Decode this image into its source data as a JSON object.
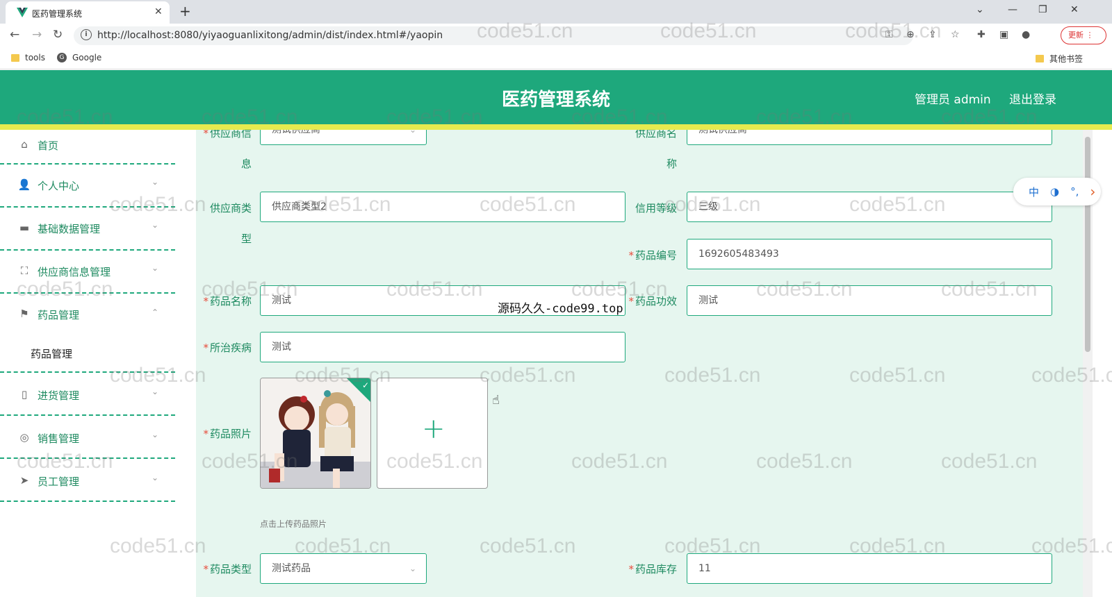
{
  "browser": {
    "tab_title": "医药管理系统",
    "url": "http://localhost:8080/yiyaoguanlixitong/admin/dist/index.html#/yaopin",
    "update_label": "更新",
    "bookmarks": [
      "tools",
      "Google"
    ],
    "other_bookmarks": "其他书签"
  },
  "header": {
    "title": "医药管理系统",
    "user_label": "管理员 admin",
    "logout_label": "退出登录"
  },
  "sidebar": {
    "items": [
      {
        "label": "首页"
      },
      {
        "label": "个人中心"
      },
      {
        "label": "基础数据管理"
      },
      {
        "label": "供应商信息管理"
      },
      {
        "label": "药品管理"
      },
      {
        "label": "进货管理"
      },
      {
        "label": "销售管理"
      },
      {
        "label": "员工管理"
      }
    ],
    "sub_active": "药品管理"
  },
  "form": {
    "supplier_info_label_a": "供应商信",
    "supplier_info_label_b": "息",
    "supplier_info_value": "测试供应商",
    "supplier_name_label_a": "供应商名",
    "supplier_name_label_b": "称",
    "supplier_name_value": "测试供应商",
    "supplier_type_label_a": "供应商类",
    "supplier_type_label_b": "型",
    "supplier_type_value": "供应商类型2",
    "credit_label": "信用等级",
    "credit_value": "三级",
    "drug_no_label": "药品编号",
    "drug_no_value": "1692605483493",
    "drug_name_label": "药品名称",
    "drug_name_value": "测试",
    "drug_effect_label": "药品功效",
    "drug_effect_value": "测试",
    "disease_label": "所治疾病",
    "disease_value": "测试",
    "photo_label": "药品照片",
    "upload_tip": "点击上传药品照片",
    "drug_type_label": "药品类型",
    "drug_type_value": "测试药品",
    "stock_label": "药品库存",
    "stock_value": "11"
  },
  "overlay_text": "源码久久-code99.top",
  "watermark": "code51.cn",
  "float_toolbar": [
    "中",
    "◑",
    "°,",
    "›"
  ],
  "colors": {
    "primary": "#1ea87c",
    "accent_line": "#e6ea4f",
    "main_bg": "#e6f6ef",
    "required": "#e74c3c"
  }
}
